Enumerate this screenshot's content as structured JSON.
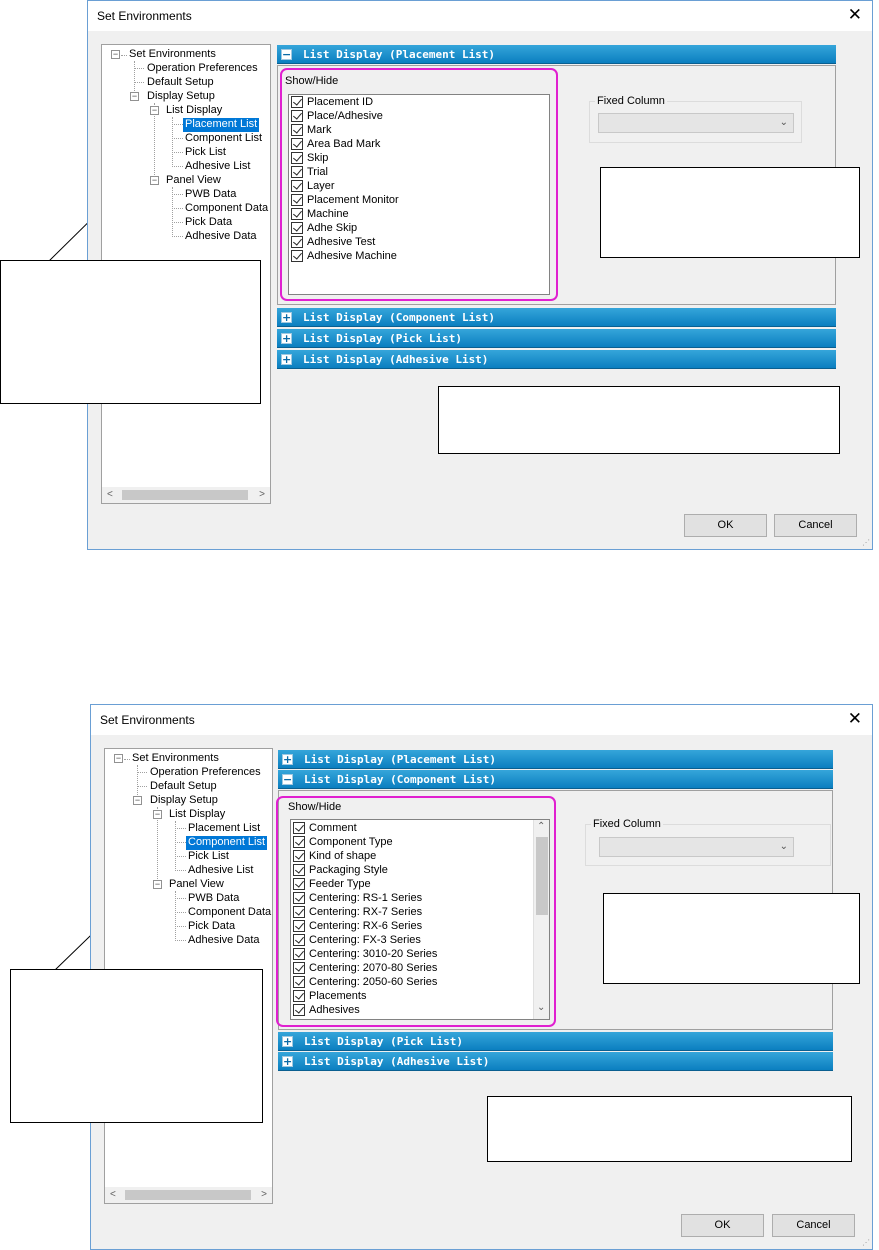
{
  "dialogs": [
    {
      "title": "Set Environments",
      "tree": {
        "root": "Set Environments",
        "operation_preferences": "Operation Preferences",
        "default_setup": "Default Setup",
        "display_setup": "Display Setup",
        "list_display": "List Display",
        "placement_list": "Placement List",
        "component_list": "Component List",
        "pick_list": "Pick List",
        "adhesive_list": "Adhesive List",
        "panel_view": "Panel View",
        "pwb_data": "PWB Data",
        "component_data": "Component Data",
        "pick_data": "Pick Data",
        "adhesive_data": "Adhesive Data",
        "selected": "Placement List"
      },
      "sections": {
        "placement": "List Display (Placement List)",
        "component": "List Display (Component List)",
        "pick": "List Display (Pick List)",
        "adhesive": "List Display (Adhesive List)"
      },
      "expanded_section": "List Display (Placement List)",
      "show_hide_label": "Show/Hide",
      "items": [
        "Placement ID",
        "Place/Adhesive",
        "Mark",
        "Area Bad Mark",
        "Skip",
        "Trial",
        "Layer",
        "Placement Monitor",
        "Machine",
        "Adhe Skip",
        "Adhesive Test",
        "Adhesive Machine"
      ],
      "fixed_column_label": "Fixed Column",
      "fixed_column_value": "",
      "ok": "OK",
      "cancel": "Cancel"
    },
    {
      "title": "Set Environments",
      "tree": {
        "root": "Set Environments",
        "operation_preferences": "Operation Preferences",
        "default_setup": "Default Setup",
        "display_setup": "Display Setup",
        "list_display": "List Display",
        "placement_list": "Placement List",
        "component_list": "Component List",
        "pick_list": "Pick List",
        "adhesive_list": "Adhesive List",
        "panel_view": "Panel View",
        "pwb_data": "PWB Data",
        "component_data": "Component Data",
        "pick_data": "Pick Data",
        "adhesive_data": "Adhesive Data",
        "selected": "Component List"
      },
      "sections": {
        "placement": "List Display (Placement List)",
        "component": "List Display (Component List)",
        "pick": "List Display (Pick List)",
        "adhesive": "List Display (Adhesive List)"
      },
      "expanded_section": "List Display (Component List)",
      "show_hide_label": "Show/Hide",
      "items": [
        "Comment",
        "Component Type",
        "Kind of shape",
        "Packaging Style",
        "Feeder Type",
        "Centering: RS-1 Series",
        "Centering: RX-7 Series",
        "Centering: RX-6 Series",
        "Centering: FX-3 Series",
        "Centering: 3010-20 Series",
        "Centering: 2070-80 Series",
        "Centering: 2050-60 Series",
        "Placements",
        "Adhesives"
      ],
      "fixed_column_label": "Fixed Column",
      "fixed_column_value": "",
      "ok": "OK",
      "cancel": "Cancel"
    }
  ],
  "colors": {
    "header_blue": "#0b7fc0",
    "selection_blue": "#0078d7",
    "highlight_magenta": "#e020d0",
    "dialog_border": "#6a9fd4"
  },
  "icons": [
    "close-icon",
    "tree-expand-icon",
    "checkbox-checked-icon",
    "chevron-down-icon",
    "scroll-left-icon",
    "scroll-right-icon",
    "scroll-up-icon",
    "scroll-down-icon",
    "size-grip-icon"
  ]
}
